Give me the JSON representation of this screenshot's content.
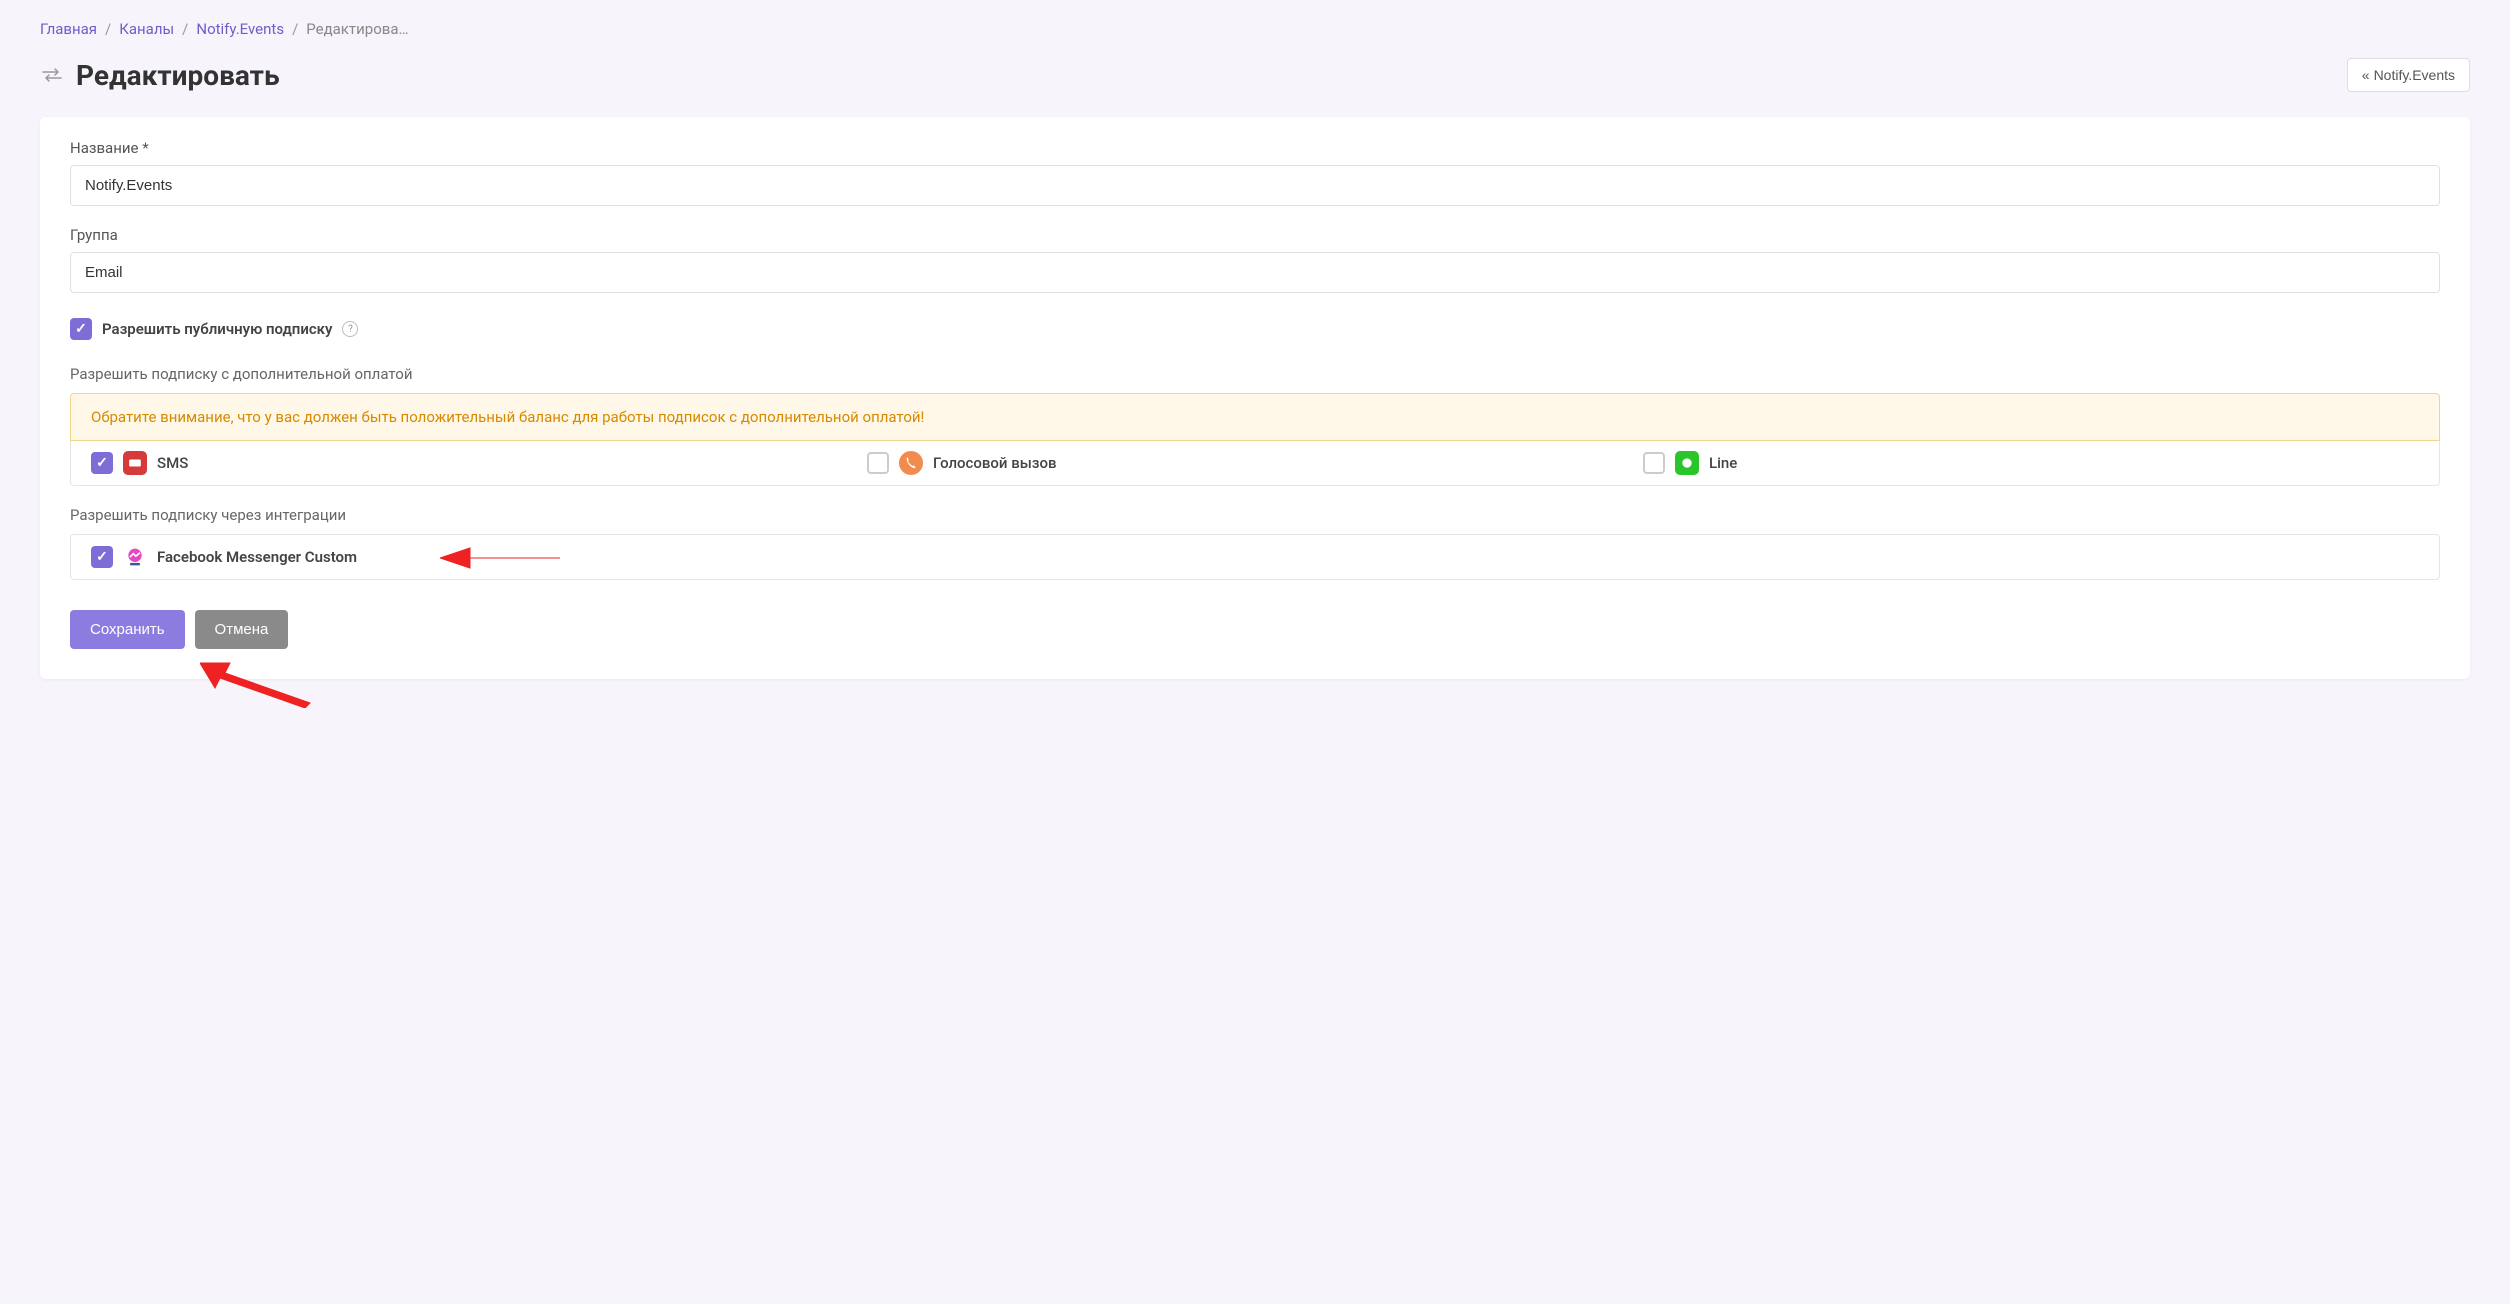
{
  "breadcrumb": {
    "home": "Главная",
    "channels": "Каналы",
    "notify": "Notify.Events",
    "current": "Редактирова…"
  },
  "page": {
    "title": "Редактировать",
    "back_label": "Notify.Events"
  },
  "form": {
    "name_label": "Название *",
    "name_value": "Notify.Events",
    "group_label": "Группа",
    "group_value": "Email",
    "public_sub_label": "Разрешить публичную подписку",
    "paid_sub_label": "Разрешить подписку с дополнительной оплатой",
    "paid_sub_warning": "Обратите внимание, что у вас должен быть положительный баланс для работы подписок с дополнительной оплатой!",
    "integration_sub_label": "Разрешить подписку через интеграции"
  },
  "paid_options": {
    "sms": "SMS",
    "voice": "Голосовой вызов",
    "line": "Line"
  },
  "integration_options": {
    "fb": "Facebook Messenger Custom"
  },
  "buttons": {
    "save": "Сохранить",
    "cancel": "Отмена"
  }
}
